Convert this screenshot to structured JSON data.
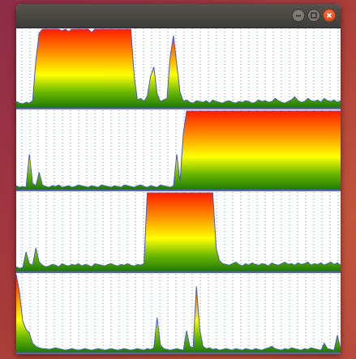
{
  "window": {
    "title": "",
    "buttons": {
      "minimize": "minimize-icon",
      "maximize": "maximize-icon",
      "close": "close-icon"
    }
  },
  "colors": {
    "gradient_top": "#ff1a00",
    "gradient_upper": "#ff7a00",
    "gradient_mid": "#ffff00",
    "gradient_lower": "#6cb800",
    "gradient_bottom": "#1e7a00",
    "outline": "#4a5ac8",
    "grid": "#6c8fe0",
    "baseline": "#2233aa"
  },
  "chart_data": [
    {
      "type": "area",
      "ylim": [
        0,
        100
      ],
      "grid": "vertical-dotted",
      "values": [
        8,
        6,
        5,
        7,
        6,
        9,
        60,
        95,
        100,
        100,
        100,
        100,
        100,
        100,
        98,
        100,
        97,
        100,
        100,
        100,
        100,
        100,
        100,
        96,
        100,
        100,
        100,
        100,
        100,
        100,
        100,
        100,
        100,
        100,
        100,
        100,
        40,
        10,
        12,
        8,
        15,
        40,
        52,
        18,
        8,
        10,
        12,
        65,
        92,
        55,
        20,
        8,
        10,
        7,
        6,
        9,
        8,
        7,
        9,
        6,
        10,
        8,
        7,
        6,
        8,
        9,
        7,
        6,
        8,
        7,
        9,
        8,
        6,
        7,
        10,
        8,
        9,
        7,
        8,
        12,
        9,
        7,
        6,
        8,
        10,
        14,
        9,
        7,
        8,
        12,
        9,
        8,
        10,
        7,
        12,
        9,
        8,
        10,
        7,
        9
      ]
    },
    {
      "type": "area",
      "ylim": [
        0,
        100
      ],
      "grid": "vertical-dotted",
      "values": [
        5,
        3,
        4,
        3,
        45,
        8,
        5,
        22,
        6,
        4,
        3,
        5,
        4,
        6,
        3,
        4,
        5,
        3,
        4,
        6,
        5,
        4,
        3,
        5,
        4,
        3,
        6,
        5,
        4,
        3,
        5,
        4,
        3,
        6,
        5,
        4,
        3,
        5,
        6,
        4,
        3,
        5,
        4,
        3,
        6,
        5,
        4,
        3,
        5,
        45,
        10,
        72,
        100,
        100,
        100,
        100,
        100,
        100,
        100,
        100,
        100,
        100,
        100,
        100,
        100,
        100,
        100,
        100,
        100,
        100,
        100,
        100,
        100,
        100,
        100,
        100,
        100,
        100,
        100,
        100,
        100,
        100,
        100,
        100,
        100,
        100,
        100,
        100,
        100,
        100,
        100,
        100,
        100,
        100,
        100,
        100,
        100,
        100,
        100,
        100
      ]
    },
    {
      "type": "area",
      "ylim": [
        0,
        100
      ],
      "grid": "vertical-dotted",
      "values": [
        6,
        4,
        5,
        25,
        10,
        8,
        30,
        12,
        8,
        6,
        7,
        9,
        8,
        6,
        10,
        8,
        7,
        9,
        8,
        10,
        7,
        9,
        8,
        6,
        10,
        9,
        8,
        7,
        9,
        10,
        8,
        7,
        9,
        8,
        10,
        8,
        7,
        9,
        8,
        10,
        100,
        100,
        100,
        100,
        100,
        100,
        100,
        100,
        100,
        100,
        100,
        100,
        100,
        100,
        100,
        100,
        100,
        100,
        100,
        100,
        100,
        30,
        14,
        10,
        9,
        8,
        10,
        12,
        9,
        7,
        10,
        8,
        11,
        9,
        8,
        10,
        9,
        7,
        11,
        9,
        8,
        10,
        12,
        9,
        10,
        8,
        11,
        9,
        10,
        12,
        8,
        10,
        9,
        11,
        8,
        10,
        12,
        9,
        11,
        8
      ]
    },
    {
      "type": "area",
      "ylim": [
        0,
        100
      ],
      "grid": "vertical-dotted",
      "values": [
        100,
        78,
        40,
        30,
        25,
        12,
        8,
        6,
        5,
        5,
        4,
        5,
        6,
        5,
        4,
        3,
        4,
        5,
        4,
        3,
        4,
        5,
        4,
        3,
        4,
        5,
        4,
        3,
        4,
        5,
        4,
        3,
        4,
        5,
        4,
        3,
        4,
        5,
        4,
        3,
        5,
        4,
        6,
        45,
        10,
        5,
        4,
        3,
        4,
        5,
        4,
        3,
        28,
        8,
        6,
        85,
        30,
        8,
        5,
        6,
        4,
        5,
        3,
        4,
        5,
        4,
        3,
        5,
        4,
        3,
        5,
        4,
        3,
        5,
        4,
        3,
        5,
        6,
        8,
        5,
        4,
        3,
        5,
        4,
        6,
        5,
        4,
        3,
        5,
        4,
        6,
        5,
        4,
        3,
        12,
        5,
        4,
        3,
        22,
        5
      ]
    }
  ]
}
